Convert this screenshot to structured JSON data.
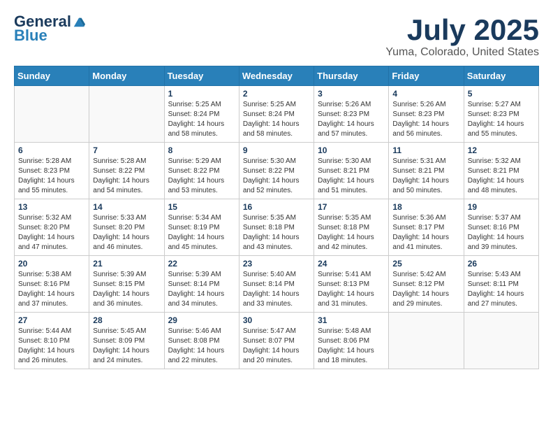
{
  "header": {
    "logo_general": "General",
    "logo_blue": "Blue",
    "month_title": "July 2025",
    "location": "Yuma, Colorado, United States"
  },
  "weekdays": [
    "Sunday",
    "Monday",
    "Tuesday",
    "Wednesday",
    "Thursday",
    "Friday",
    "Saturday"
  ],
  "weeks": [
    [
      {
        "day": "",
        "sunrise": "",
        "sunset": "",
        "daylight": ""
      },
      {
        "day": "",
        "sunrise": "",
        "sunset": "",
        "daylight": ""
      },
      {
        "day": "1",
        "sunrise": "Sunrise: 5:25 AM",
        "sunset": "Sunset: 8:24 PM",
        "daylight": "Daylight: 14 hours and 58 minutes."
      },
      {
        "day": "2",
        "sunrise": "Sunrise: 5:25 AM",
        "sunset": "Sunset: 8:24 PM",
        "daylight": "Daylight: 14 hours and 58 minutes."
      },
      {
        "day": "3",
        "sunrise": "Sunrise: 5:26 AM",
        "sunset": "Sunset: 8:23 PM",
        "daylight": "Daylight: 14 hours and 57 minutes."
      },
      {
        "day": "4",
        "sunrise": "Sunrise: 5:26 AM",
        "sunset": "Sunset: 8:23 PM",
        "daylight": "Daylight: 14 hours and 56 minutes."
      },
      {
        "day": "5",
        "sunrise": "Sunrise: 5:27 AM",
        "sunset": "Sunset: 8:23 PM",
        "daylight": "Daylight: 14 hours and 55 minutes."
      }
    ],
    [
      {
        "day": "6",
        "sunrise": "Sunrise: 5:28 AM",
        "sunset": "Sunset: 8:23 PM",
        "daylight": "Daylight: 14 hours and 55 minutes."
      },
      {
        "day": "7",
        "sunrise": "Sunrise: 5:28 AM",
        "sunset": "Sunset: 8:22 PM",
        "daylight": "Daylight: 14 hours and 54 minutes."
      },
      {
        "day": "8",
        "sunrise": "Sunrise: 5:29 AM",
        "sunset": "Sunset: 8:22 PM",
        "daylight": "Daylight: 14 hours and 53 minutes."
      },
      {
        "day": "9",
        "sunrise": "Sunrise: 5:30 AM",
        "sunset": "Sunset: 8:22 PM",
        "daylight": "Daylight: 14 hours and 52 minutes."
      },
      {
        "day": "10",
        "sunrise": "Sunrise: 5:30 AM",
        "sunset": "Sunset: 8:21 PM",
        "daylight": "Daylight: 14 hours and 51 minutes."
      },
      {
        "day": "11",
        "sunrise": "Sunrise: 5:31 AM",
        "sunset": "Sunset: 8:21 PM",
        "daylight": "Daylight: 14 hours and 50 minutes."
      },
      {
        "day": "12",
        "sunrise": "Sunrise: 5:32 AM",
        "sunset": "Sunset: 8:21 PM",
        "daylight": "Daylight: 14 hours and 48 minutes."
      }
    ],
    [
      {
        "day": "13",
        "sunrise": "Sunrise: 5:32 AM",
        "sunset": "Sunset: 8:20 PM",
        "daylight": "Daylight: 14 hours and 47 minutes."
      },
      {
        "day": "14",
        "sunrise": "Sunrise: 5:33 AM",
        "sunset": "Sunset: 8:20 PM",
        "daylight": "Daylight: 14 hours and 46 minutes."
      },
      {
        "day": "15",
        "sunrise": "Sunrise: 5:34 AM",
        "sunset": "Sunset: 8:19 PM",
        "daylight": "Daylight: 14 hours and 45 minutes."
      },
      {
        "day": "16",
        "sunrise": "Sunrise: 5:35 AM",
        "sunset": "Sunset: 8:18 PM",
        "daylight": "Daylight: 14 hours and 43 minutes."
      },
      {
        "day": "17",
        "sunrise": "Sunrise: 5:35 AM",
        "sunset": "Sunset: 8:18 PM",
        "daylight": "Daylight: 14 hours and 42 minutes."
      },
      {
        "day": "18",
        "sunrise": "Sunrise: 5:36 AM",
        "sunset": "Sunset: 8:17 PM",
        "daylight": "Daylight: 14 hours and 41 minutes."
      },
      {
        "day": "19",
        "sunrise": "Sunrise: 5:37 AM",
        "sunset": "Sunset: 8:16 PM",
        "daylight": "Daylight: 14 hours and 39 minutes."
      }
    ],
    [
      {
        "day": "20",
        "sunrise": "Sunrise: 5:38 AM",
        "sunset": "Sunset: 8:16 PM",
        "daylight": "Daylight: 14 hours and 37 minutes."
      },
      {
        "day": "21",
        "sunrise": "Sunrise: 5:39 AM",
        "sunset": "Sunset: 8:15 PM",
        "daylight": "Daylight: 14 hours and 36 minutes."
      },
      {
        "day": "22",
        "sunrise": "Sunrise: 5:39 AM",
        "sunset": "Sunset: 8:14 PM",
        "daylight": "Daylight: 14 hours and 34 minutes."
      },
      {
        "day": "23",
        "sunrise": "Sunrise: 5:40 AM",
        "sunset": "Sunset: 8:14 PM",
        "daylight": "Daylight: 14 hours and 33 minutes."
      },
      {
        "day": "24",
        "sunrise": "Sunrise: 5:41 AM",
        "sunset": "Sunset: 8:13 PM",
        "daylight": "Daylight: 14 hours and 31 minutes."
      },
      {
        "day": "25",
        "sunrise": "Sunrise: 5:42 AM",
        "sunset": "Sunset: 8:12 PM",
        "daylight": "Daylight: 14 hours and 29 minutes."
      },
      {
        "day": "26",
        "sunrise": "Sunrise: 5:43 AM",
        "sunset": "Sunset: 8:11 PM",
        "daylight": "Daylight: 14 hours and 27 minutes."
      }
    ],
    [
      {
        "day": "27",
        "sunrise": "Sunrise: 5:44 AM",
        "sunset": "Sunset: 8:10 PM",
        "daylight": "Daylight: 14 hours and 26 minutes."
      },
      {
        "day": "28",
        "sunrise": "Sunrise: 5:45 AM",
        "sunset": "Sunset: 8:09 PM",
        "daylight": "Daylight: 14 hours and 24 minutes."
      },
      {
        "day": "29",
        "sunrise": "Sunrise: 5:46 AM",
        "sunset": "Sunset: 8:08 PM",
        "daylight": "Daylight: 14 hours and 22 minutes."
      },
      {
        "day": "30",
        "sunrise": "Sunrise: 5:47 AM",
        "sunset": "Sunset: 8:07 PM",
        "daylight": "Daylight: 14 hours and 20 minutes."
      },
      {
        "day": "31",
        "sunrise": "Sunrise: 5:48 AM",
        "sunset": "Sunset: 8:06 PM",
        "daylight": "Daylight: 14 hours and 18 minutes."
      },
      {
        "day": "",
        "sunrise": "",
        "sunset": "",
        "daylight": ""
      },
      {
        "day": "",
        "sunrise": "",
        "sunset": "",
        "daylight": ""
      }
    ]
  ]
}
